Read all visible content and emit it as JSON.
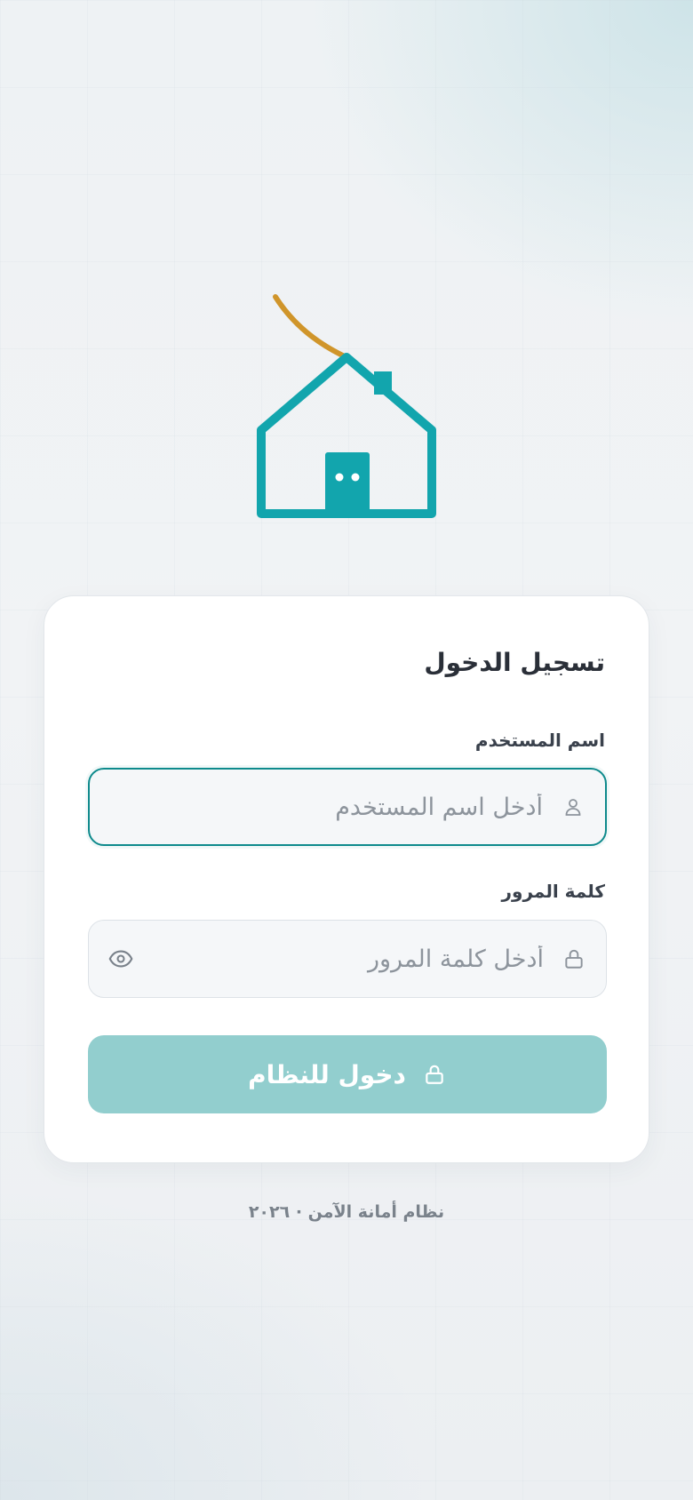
{
  "login": {
    "title": "تسجيل الدخول",
    "username": {
      "label": "اسم المستخدم",
      "placeholder": "أدخل اسم المستخدم",
      "value": ""
    },
    "password": {
      "label": "كلمة المرور",
      "placeholder": "أدخل كلمة المرور",
      "value": ""
    },
    "submit_label": "دخول للنظام"
  },
  "footer": {
    "text": "نظام أمانة الآمن · ٢٠٢٦"
  },
  "colors": {
    "brand": "#12a5ad",
    "accent": "#d0952a",
    "focus_border": "#0e8a8c",
    "button_bg": "#92cece"
  },
  "icons": {
    "logo": "house-logo",
    "username": "user-icon",
    "password": "lock-icon",
    "toggle": "eye-icon",
    "submit": "lock-icon"
  }
}
